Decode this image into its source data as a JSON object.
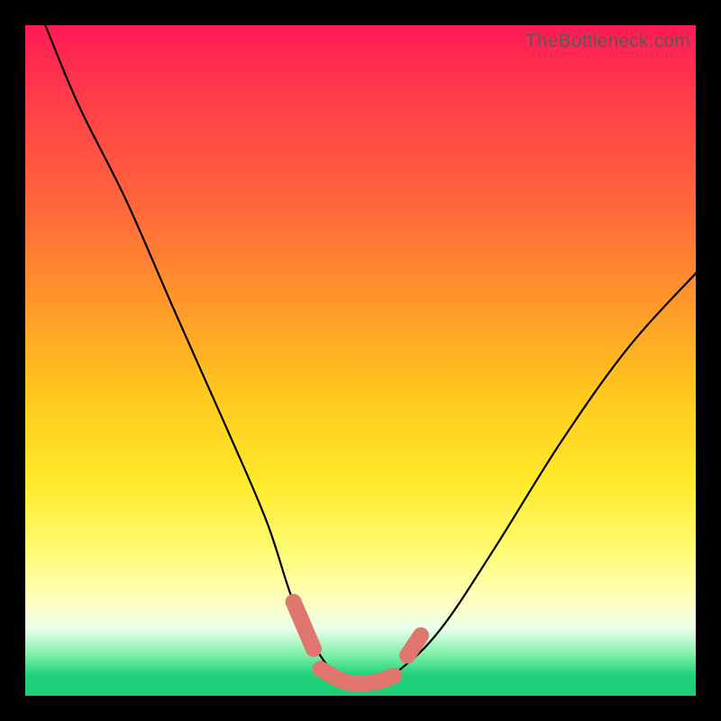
{
  "watermark": "TheBottleneck.com",
  "chart_data": {
    "type": "line",
    "title": "",
    "xlabel": "",
    "ylabel": "",
    "xlim": [
      0,
      100
    ],
    "ylim": [
      0,
      100
    ],
    "grid": false,
    "legend": false,
    "series": [
      {
        "name": "bottleneck-curve",
        "type": "line",
        "color": "#000000",
        "x": [
          3,
          8,
          15,
          22,
          30,
          36,
          40,
          44,
          48,
          52,
          56,
          62,
          70,
          80,
          90,
          100
        ],
        "y": [
          100,
          88,
          74,
          58,
          40,
          26,
          14,
          6,
          2,
          2,
          4,
          10,
          22,
          38,
          52,
          63
        ]
      }
    ],
    "markers": [
      {
        "name": "highlight-left",
        "type": "line",
        "color": "#e0766d",
        "x": [
          40,
          43
        ],
        "y": [
          14,
          7
        ]
      },
      {
        "name": "highlight-bottom",
        "type": "line",
        "color": "#e0766d",
        "x": [
          44,
          48,
          52,
          55
        ],
        "y": [
          4,
          2,
          2,
          3
        ]
      },
      {
        "name": "highlight-right",
        "type": "line",
        "color": "#e0766d",
        "x": [
          57,
          59
        ],
        "y": [
          6,
          9
        ]
      }
    ]
  }
}
